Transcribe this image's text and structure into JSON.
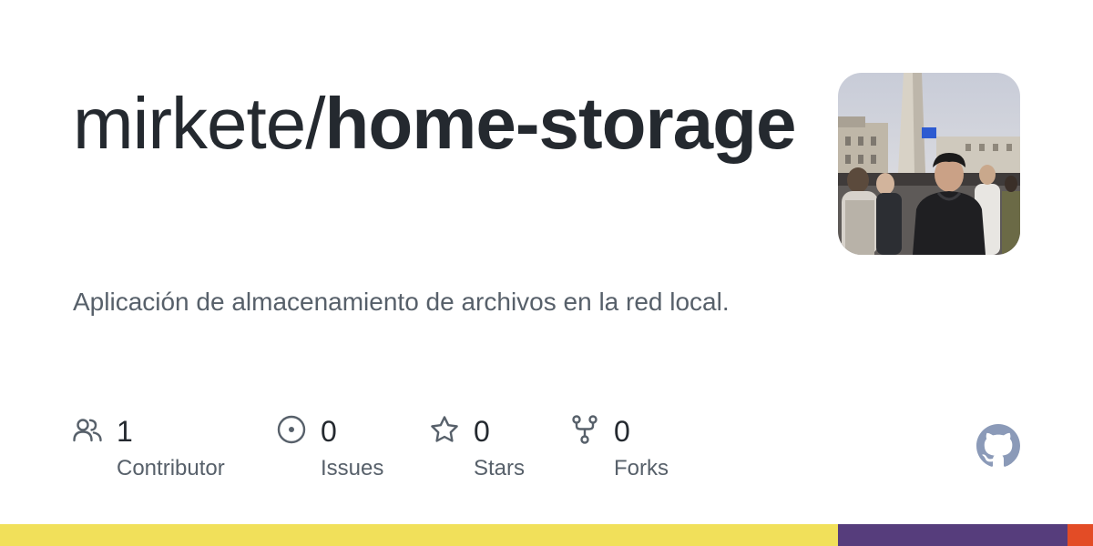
{
  "repo": {
    "owner": "mirkete/",
    "name": "home-storage",
    "description": "Aplicación de almacenamiento de archivos en la red local."
  },
  "stats": [
    {
      "icon": "people-icon",
      "value": "1",
      "label": "Contributor"
    },
    {
      "icon": "issue-icon",
      "value": "0",
      "label": "Issues"
    },
    {
      "icon": "star-icon",
      "value": "0",
      "label": "Stars"
    },
    {
      "icon": "fork-icon",
      "value": "0",
      "label": "Forks"
    }
  ],
  "avatar": {
    "icon": "user-avatar-photo"
  },
  "brand_logo": {
    "icon": "github-icon"
  },
  "colors": {
    "title": "#24292f",
    "muted": "#57606a",
    "icon": "#57606a"
  },
  "languages": [
    {
      "color": "#f1e05a",
      "share": 0.767
    },
    {
      "color": "#563d7c",
      "share": 0.21
    },
    {
      "color": "#e34c26",
      "share": 0.023
    }
  ]
}
